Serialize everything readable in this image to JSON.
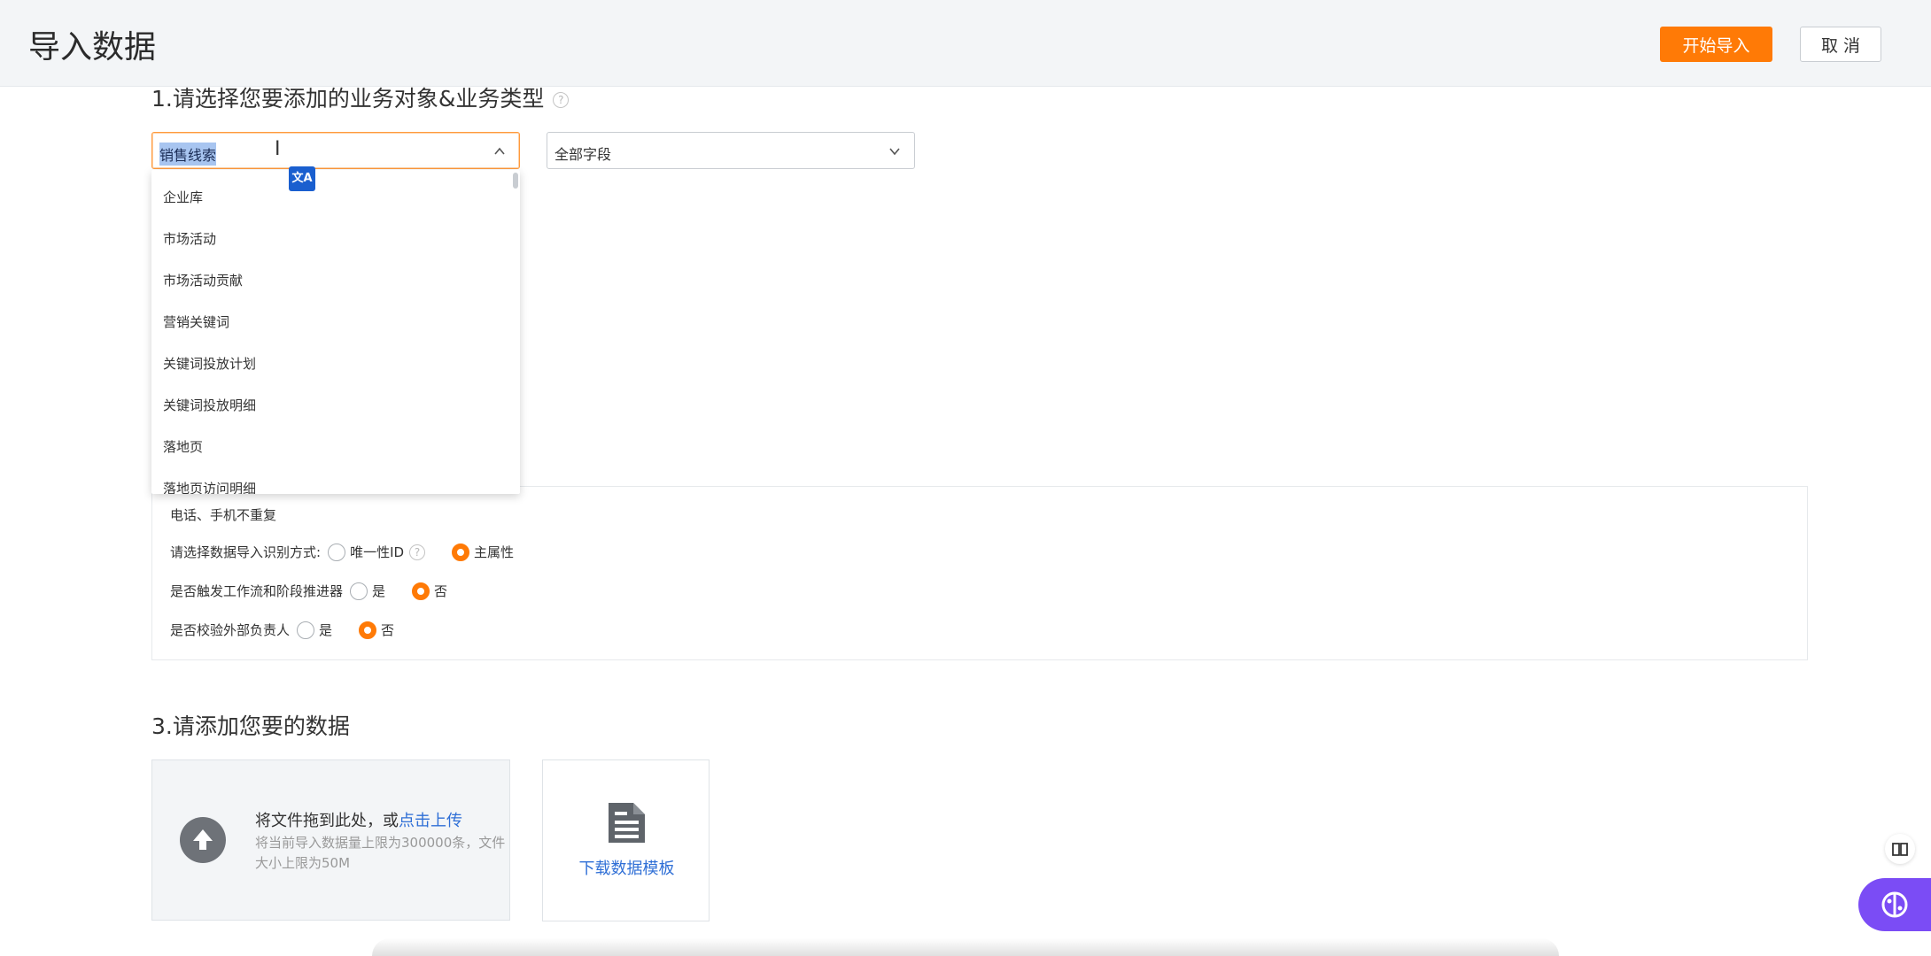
{
  "header": {
    "title": "导入数据",
    "start_button": "开始导入",
    "cancel_button": "取 消"
  },
  "section1": {
    "title": "1.请选择您要添加的业务对象&业务类型",
    "object_select": {
      "value": "销售线索"
    },
    "type_select": {
      "value": "全部字段"
    },
    "dropdown_options": [
      "企业库",
      "市场活动",
      "市场活动贡献",
      "营销关键词",
      "关键词投放计划",
      "关键词投放明细",
      "落地页",
      "落地页访问明细"
    ]
  },
  "options": {
    "dedupe_note": "电话、手机不重复",
    "identify": {
      "label": "请选择数据导入识别方式:",
      "option_a": "唯一性ID",
      "option_b": "主属性",
      "selected": "主属性"
    },
    "workflow": {
      "label": "是否触发工作流和阶段推进器",
      "yes": "是",
      "no": "否",
      "selected": "否"
    },
    "owner_check": {
      "label": "是否校验外部负责人",
      "yes": "是",
      "no": "否",
      "selected": "否"
    }
  },
  "section3": {
    "title": "3.请添加您要的数据",
    "upload_text": "将文件拖到此处，或",
    "upload_link": "点击上传",
    "upload_hint": "将当前导入数据量上限为300000条，文件大小上限为50M",
    "template_label": "下载数据模板"
  },
  "icons": {
    "help": "help-icon",
    "upload": "upload-arrow-icon",
    "template": "document-icon",
    "translate": "translate-icon",
    "book": "book-icon",
    "ai": "brain-icon"
  },
  "colors": {
    "accent": "#ff7a06",
    "link": "#2f6fd6",
    "ai_button": "#7b4cf5"
  }
}
